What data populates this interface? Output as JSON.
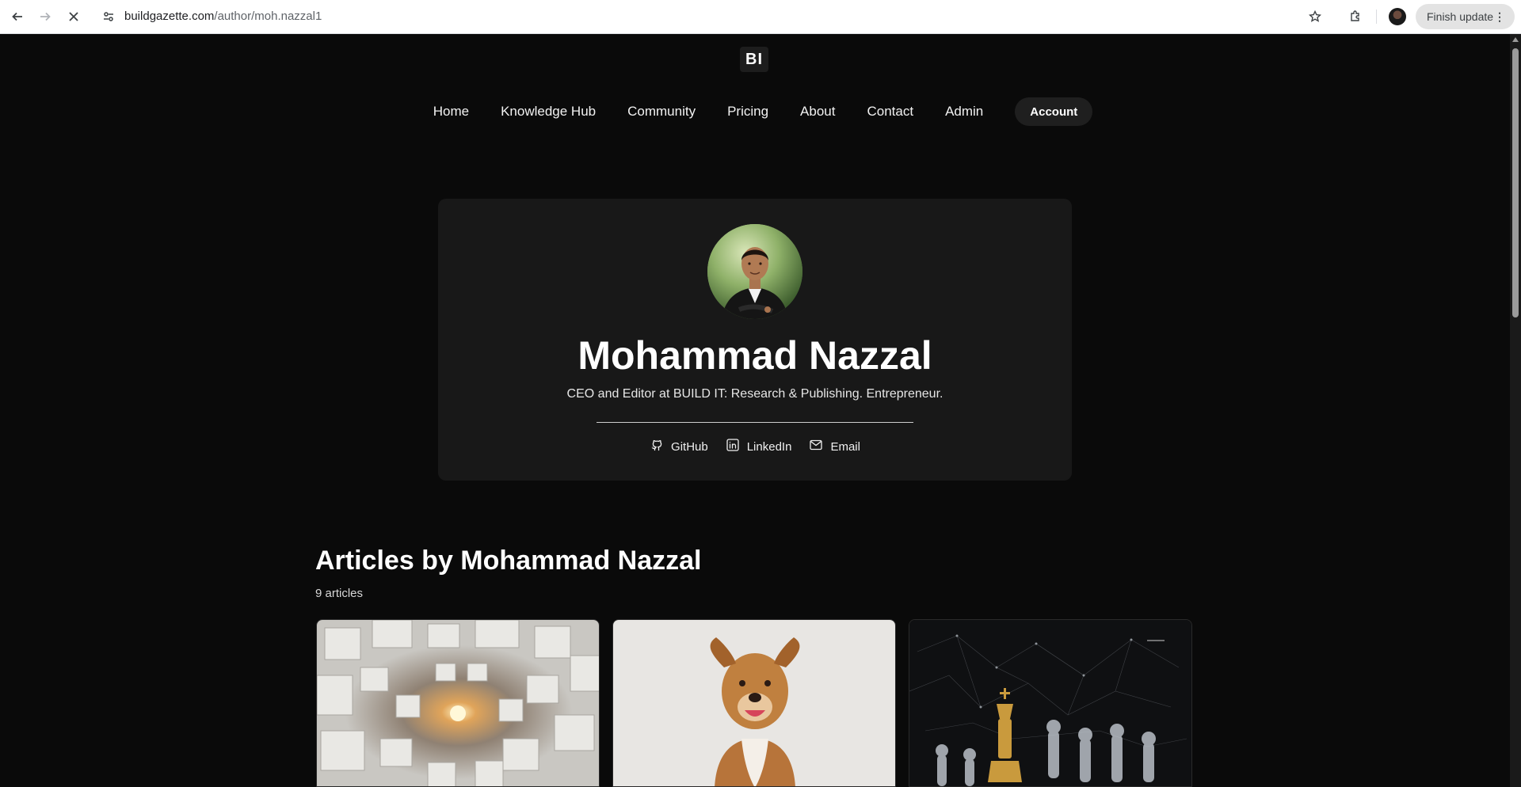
{
  "browser": {
    "url_host": "buildgazette.com",
    "url_path": "/author/moh.nazzal1",
    "update_label": "Finish update",
    "icons": [
      "back-icon",
      "forward-icon",
      "stop-loading-icon",
      "site-info-icon",
      "bookmark-star-icon",
      "extensions-icon",
      "profile-avatar",
      "kebab-menu-icon"
    ]
  },
  "site": {
    "logo_text": "BI",
    "nav": [
      {
        "label": "Home"
      },
      {
        "label": "Knowledge Hub"
      },
      {
        "label": "Community"
      },
      {
        "label": "Pricing"
      },
      {
        "label": "About"
      },
      {
        "label": "Contact"
      },
      {
        "label": "Admin"
      }
    ],
    "account_label": "Account"
  },
  "author": {
    "name": "Mohammad Nazzal",
    "bio": "CEO and Editor at BUILD IT: Research & Publishing. Entrepreneur.",
    "socials": [
      {
        "label": "GitHub",
        "icon": "github-icon"
      },
      {
        "label": "LinkedIn",
        "icon": "linkedin-icon"
      },
      {
        "label": "Email",
        "icon": "mail-icon"
      }
    ]
  },
  "articles": {
    "title": "Articles by Mohammad Nazzal",
    "count_label": "9 articles",
    "cards": [
      {
        "image": "abstract-white-cubes-tunnel"
      },
      {
        "image": "smiling-brown-dog"
      },
      {
        "image": "golden-chess-king"
      }
    ]
  },
  "colors": {
    "page_bg": "#0a0a0a",
    "card_bg": "#181818",
    "button_bg": "#1f1f1f",
    "text": "#ffffff"
  }
}
